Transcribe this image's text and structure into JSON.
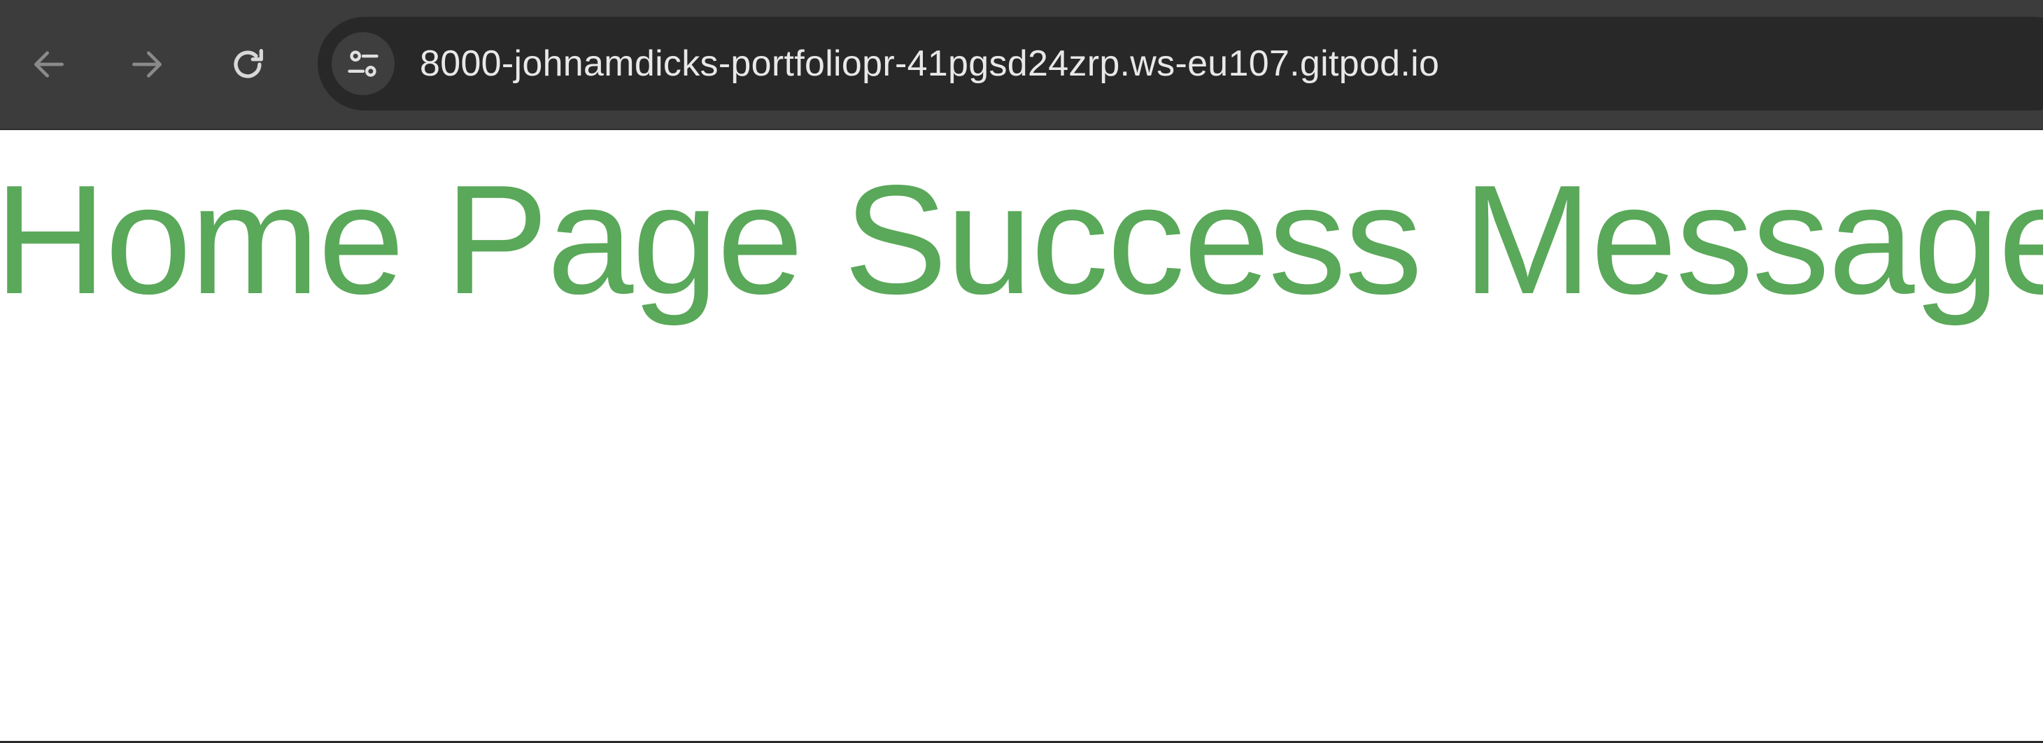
{
  "browser": {
    "url": "8000-johnamdicks-portfoliopr-41pgsd24zrp.ws-eu107.gitpod.io",
    "icons": {
      "back": "arrow-left-icon",
      "forward": "arrow-right-icon",
      "reload": "reload-icon",
      "site_info": "tune-icon"
    },
    "colors": {
      "toolbar_bg": "#3c3c3c",
      "omnibox_bg": "#282828",
      "url_text": "#e8e8e8"
    }
  },
  "page": {
    "heading": "Home Page Success Message!",
    "colors": {
      "heading": "#5aa85a",
      "background": "#ffffff"
    }
  }
}
